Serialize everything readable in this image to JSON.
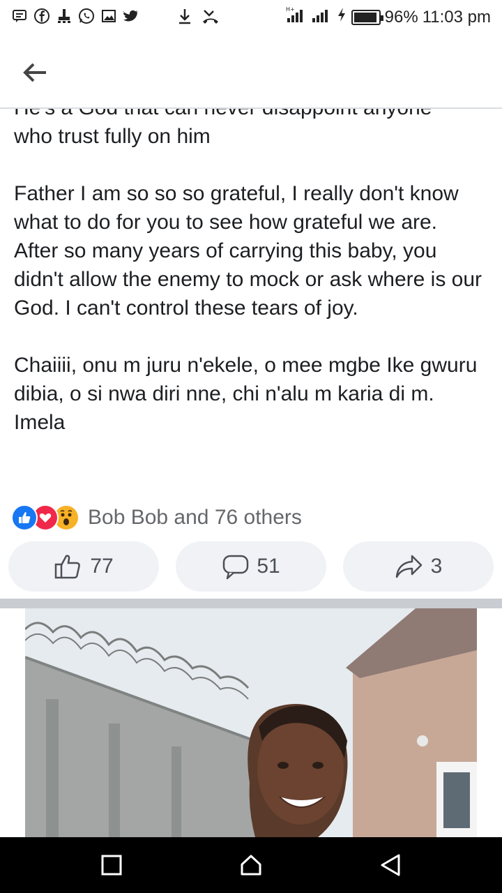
{
  "status_bar": {
    "battery": "96%",
    "battery_level": 0.96,
    "time": "11:03 pm",
    "notification_icons": [
      "message-icon",
      "facebook-icon",
      "usb-icon",
      "whatsapp-icon",
      "gallery-icon",
      "twitter-icon",
      "download-icon",
      "missed-call-icon"
    ],
    "system_icons": [
      "signal-4g-icon",
      "signal-icon",
      "charging-icon",
      "battery-icon"
    ]
  },
  "header": {
    "back_icon": "back-arrow-icon"
  },
  "post": {
    "text_lines_partial": "He's a God that can never disappoint anyone",
    "paragraph1_end": "who trust fully on him",
    "paragraph2": "Father I am so so so grateful, I really don't know what to do for you to see how grateful we are.",
    "paragraph3": "After so many years of carrying this baby, you didn't allow the enemy to mock or ask where is our God. I can't control these tears of joy.",
    "paragraph4": "Chaiiii, onu m juru n'ekele, o mee mgbe Ike gwuru dibia, o si nwa diri nne, chi n'alu m karia di m. Imela"
  },
  "reactions": {
    "types": [
      "like-icon",
      "love-icon",
      "wow-icon"
    ],
    "summary": "Bob Bob and 76 others"
  },
  "actions": {
    "like_count": "77",
    "comment_count": "51",
    "share_count": "3"
  },
  "colors": {
    "fb_blue": "#1877f2",
    "love_red": "#f02849",
    "wow_yellow": "#f7b125",
    "button_bg": "#f0f2f5",
    "secondary_text": "#65676b"
  },
  "nav_bar": {
    "recents_icon": "recents-icon",
    "home_icon": "home-icon",
    "back_icon": "back-icon"
  }
}
